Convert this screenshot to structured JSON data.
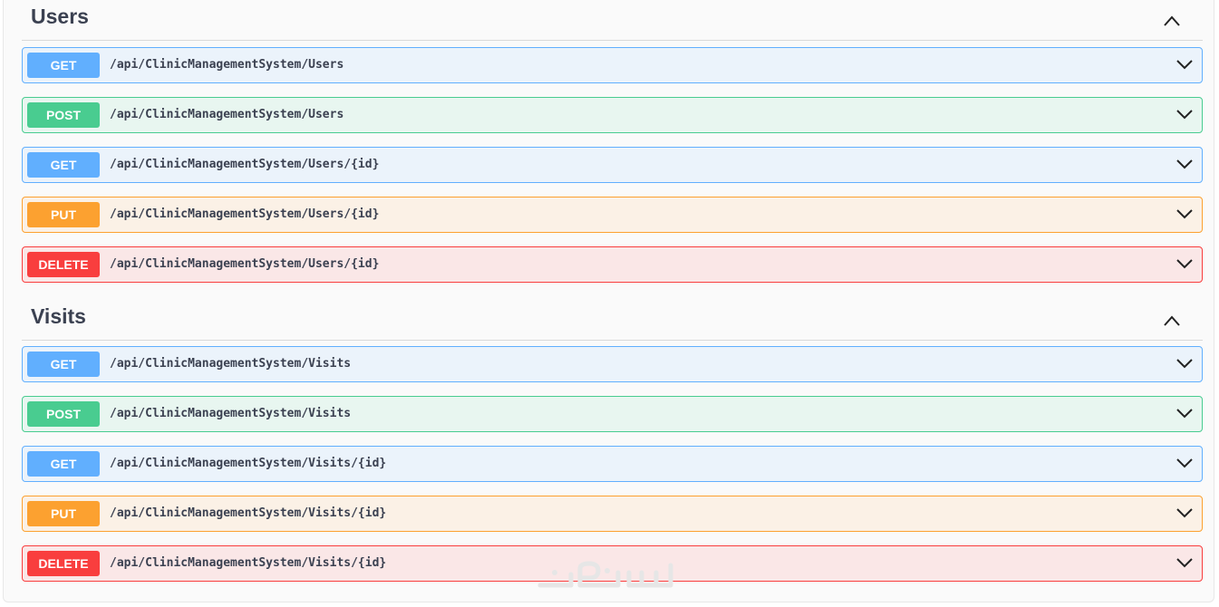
{
  "sections": [
    {
      "title": "Users",
      "toggle_icon": "chevron-up-icon",
      "operations": [
        {
          "method": "GET",
          "path": "/api/ClinicManagementSystem/Users"
        },
        {
          "method": "POST",
          "path": "/api/ClinicManagementSystem/Users"
        },
        {
          "method": "GET",
          "path": "/api/ClinicManagementSystem/Users/{id}"
        },
        {
          "method": "PUT",
          "path": "/api/ClinicManagementSystem/Users/{id}"
        },
        {
          "method": "DELETE",
          "path": "/api/ClinicManagementSystem/Users/{id}"
        }
      ]
    },
    {
      "title": "Visits",
      "toggle_icon": "chevron-up-icon",
      "operations": [
        {
          "method": "GET",
          "path": "/api/ClinicManagementSystem/Visits"
        },
        {
          "method": "POST",
          "path": "/api/ClinicManagementSystem/Visits"
        },
        {
          "method": "GET",
          "path": "/api/ClinicManagementSystem/Visits/{id}"
        },
        {
          "method": "PUT",
          "path": "/api/ClinicManagementSystem/Visits/{id}"
        },
        {
          "method": "DELETE",
          "path": "/api/ClinicManagementSystem/Visits/{id}"
        }
      ]
    }
  ],
  "colors": {
    "get": "#61affe",
    "post": "#49cc90",
    "put": "#fca130",
    "delete": "#f93e3e",
    "text": "#3b4151"
  },
  "operation_toggle_icon": "chevron-down-icon",
  "watermark_icon": "khamsat-logo-icon"
}
